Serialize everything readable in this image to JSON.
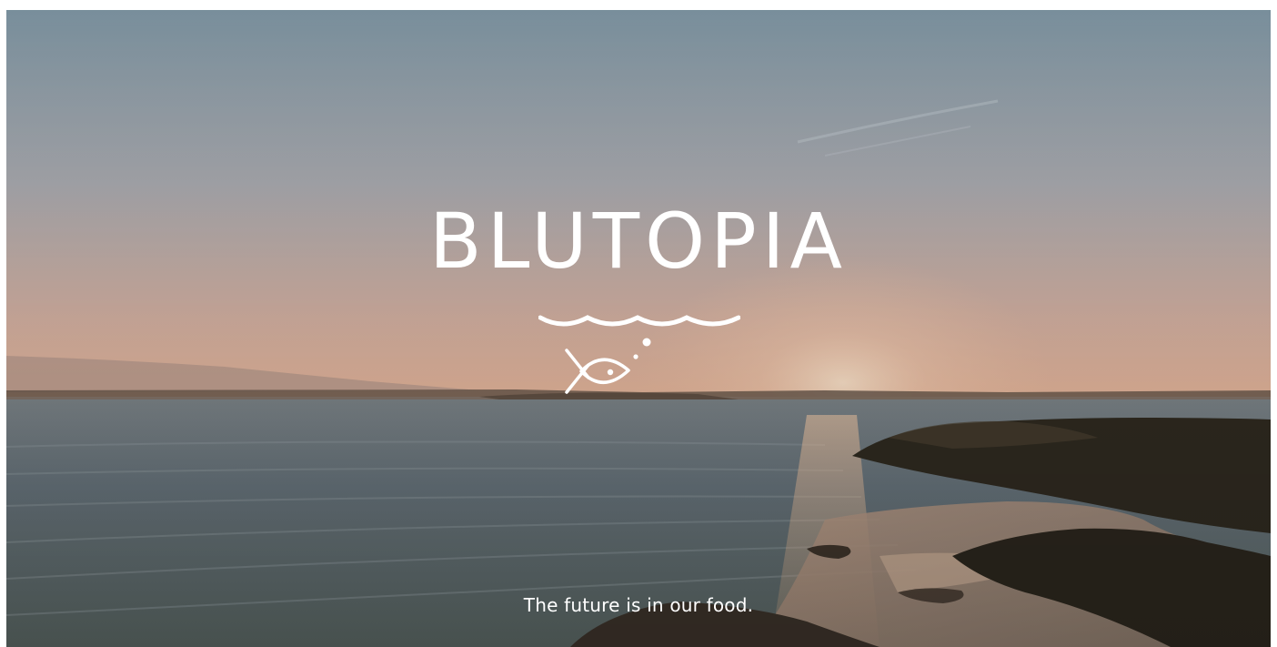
{
  "brand": {
    "name": "BLUTOPIA",
    "logo_icons": [
      "wave-icon",
      "fish-icon"
    ]
  },
  "hero": {
    "tagline": "The future is in our food."
  },
  "colors": {
    "text": "#ffffff",
    "sky_top": "#7b8f9a",
    "sky_glow": "#e2b9a1",
    "sea": "#5c6c70",
    "land": "#3b3426"
  }
}
